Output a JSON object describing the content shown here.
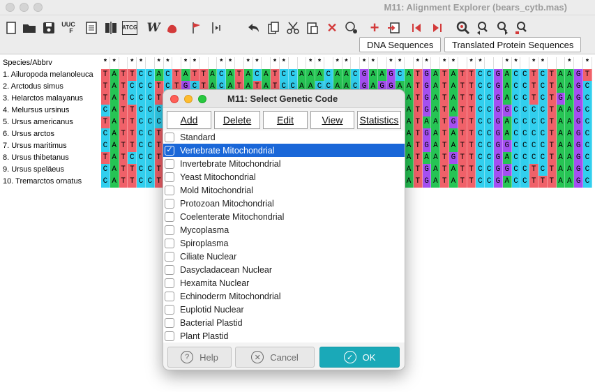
{
  "window": {
    "title": "M11: Alignment Explorer (bears_cytb.mas)"
  },
  "toolbar": {
    "icons": [
      "new-file-icon",
      "open-folder-icon",
      "save-icon",
      "uuc-translate-icon",
      "report-icon",
      "columns-icon",
      "atcg-icon",
      "web-icon",
      "hand-icon",
      "flag-icon",
      "marker-icon",
      "undo-icon",
      "copy-icon",
      "cut-icon",
      "paste-icon",
      "delete-icon",
      "clear-icon",
      "add-icon",
      "import-icon",
      "prev-icon",
      "next-icon",
      "search-icon",
      "find-prev-icon",
      "find-next-icon",
      "find-motif-icon"
    ],
    "uuc_label": "UUC",
    "uuc_sub": "F",
    "atcg_label": "ATCG"
  },
  "tabs": {
    "dna": "DNA Sequences",
    "protein": "Translated Protein Sequences"
  },
  "alignment": {
    "header_label": "Species/Abbrv",
    "header_marks": "**.**.**.**..**.**.**..**.**.**.**.**.**.**..**.**..*.**.**",
    "species": [
      "1. Ailuropoda melanoleuca",
      "2. Arctodus simus",
      "3. Helarctos malayanus",
      "4. Melursus ursinus",
      "5. Ursus americanus",
      "6. Ursus arctos",
      "7. Ursus maritimus",
      "8. Ursus thibetanus",
      "9. Ursus speläeus",
      "10. Tremarctos ornatus"
    ],
    "sequences": [
      "TATTCCACTATTACATACATCCAAACAACGAAGCATGATATTCCGACCTCTAAGT",
      "TATCCCTCTGCTACATATATCCAACCAACGAGGAATGATATTCCGACCTCTAAGC",
      "TATCCCTCTATTTCATACATCCAACCAAGGAAGCATGATATTCCGACCTCTGAGC",
      "CATTCCCCTATTACATACATCCAACCAAGGAAGCATGATATTCCGGCCCCTAAGC",
      "TATTCCCCTATTACATACATCCAACCAAGGAAGCATAATGTTCCGACCCCTAAGC",
      "CATTCCTCTATTACATACATCCAACCAAGGAAGCATGATATTCCGACCCCTAAGC",
      "CATTCCTCTATTACATACATCCAACCAAGGAAGCATGATATTCCGGCCCCTAAGC",
      "TATCCCTCTATTACATACATCCAACCAAGGAAGCATAATGTTCCGACCCCTAAGC",
      "CATTCCTCTATTACATACATCCAACCAAGGAAGCATGATATTCCGGCCTCTAAGC",
      "CATTCCTCTATTACATACATCCAACCAAGGAAGCATGATATTCCGACCTTTAAGC"
    ]
  },
  "dialog": {
    "title": "M11: Select Genetic Code",
    "buttons": [
      "Add",
      "Delete",
      "Edit",
      "View",
      "Statistics"
    ],
    "codes": [
      {
        "label": "Standard",
        "checked": false
      },
      {
        "label": "Vertebrate Mitochondrial",
        "checked": true
      },
      {
        "label": "Invertebrate Mitochondrial",
        "checked": false
      },
      {
        "label": "Yeast Mitochondrial",
        "checked": false
      },
      {
        "label": "Mold Mitochondrial",
        "checked": false
      },
      {
        "label": "Protozoan Mitochondrial",
        "checked": false
      },
      {
        "label": "Coelenterate Mitochondrial",
        "checked": false
      },
      {
        "label": "Mycoplasma",
        "checked": false
      },
      {
        "label": "Spiroplasma",
        "checked": false
      },
      {
        "label": "Ciliate Nuclear",
        "checked": false
      },
      {
        "label": "Dasycladacean Nuclear",
        "checked": false
      },
      {
        "label": "Hexamita Nuclear",
        "checked": false
      },
      {
        "label": "Echinoderm Mitochondrial",
        "checked": false
      },
      {
        "label": "Euplotid Nuclear",
        "checked": false
      },
      {
        "label": "Bacterial Plastid",
        "checked": false
      },
      {
        "label": "Plant Plastid",
        "checked": false
      }
    ],
    "selected_index": 1,
    "help_label": "Help",
    "cancel_label": "Cancel",
    "ok_label": "OK"
  },
  "colors": {
    "A": "#26c454",
    "C": "#31cfee",
    "G": "#a44ff0",
    "T": "#f06169",
    "selection": "#1a67d8",
    "ok_button": "#1aa9b8"
  }
}
